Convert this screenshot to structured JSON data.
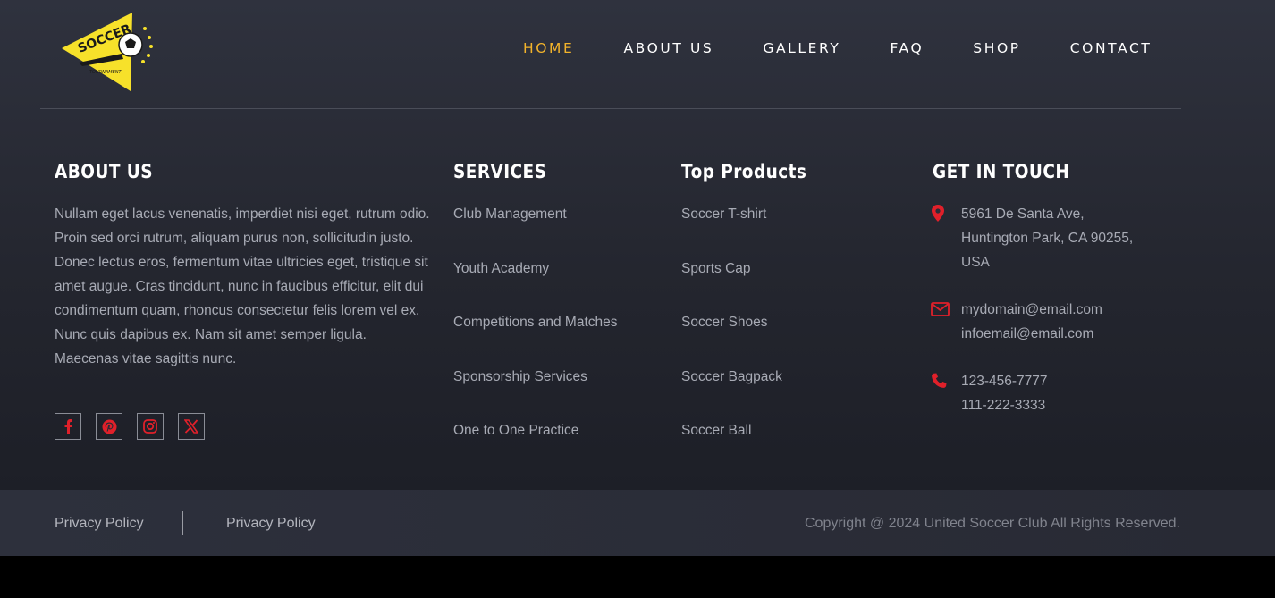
{
  "logo": {
    "top_text": "SOCCER",
    "bottom_text": "TOURNAMENT"
  },
  "nav": {
    "items": [
      {
        "label": "HOME",
        "active": true
      },
      {
        "label": "ABOUT US",
        "active": false
      },
      {
        "label": "GALLERY",
        "active": false
      },
      {
        "label": "FAQ",
        "active": false
      },
      {
        "label": "SHOP",
        "active": false
      },
      {
        "label": "CONTACT",
        "active": false
      }
    ]
  },
  "about": {
    "title": "ABOUT US",
    "text": "Nullam eget lacus venenatis, imperdiet nisi eget, rutrum odio. Proin sed orci rutrum, aliquam purus non, sollicitudin justo. Donec lectus eros, fermentum vitae ultricies eget, tristique sit amet augue. Cras tincidunt, nunc in faucibus efficitur, elit dui condimentum quam, rhoncus consectetur felis lorem vel ex. Nunc quis dapibus ex. Nam sit amet semper ligula. Maecenas vitae sagittis nunc.",
    "social": [
      "facebook-icon",
      "pinterest-icon",
      "instagram-icon",
      "x-icon"
    ]
  },
  "services": {
    "title": "SERVICES",
    "items": [
      "Club Management",
      "Youth Academy",
      "Competitions and Matches",
      "Sponsorship Services",
      "One to One Practice"
    ]
  },
  "products": {
    "title": "Top Products",
    "items": [
      "Soccer T-shirt",
      "Sports Cap",
      "Soccer Shoes",
      "Soccer Bagpack",
      "Soccer Ball"
    ]
  },
  "contact": {
    "title": "GET IN TOUCH",
    "address": [
      "5961 De Santa Ave,",
      "Huntington Park, CA 90255,",
      "USA"
    ],
    "emails": [
      "mydomain@email.com",
      "infoemail@email.com"
    ],
    "phones": [
      "123-456-7777",
      "111-222-3333"
    ]
  },
  "bottom": {
    "policy_1": "Privacy Policy",
    "policy_2": "Privacy Policy",
    "copyright": "Copyright @ 2024 United Soccer Club All Rights Reserved."
  },
  "colors": {
    "accent": "#f2b32b",
    "icon_red": "#e0202a",
    "text_muted": "#a8abb5"
  }
}
